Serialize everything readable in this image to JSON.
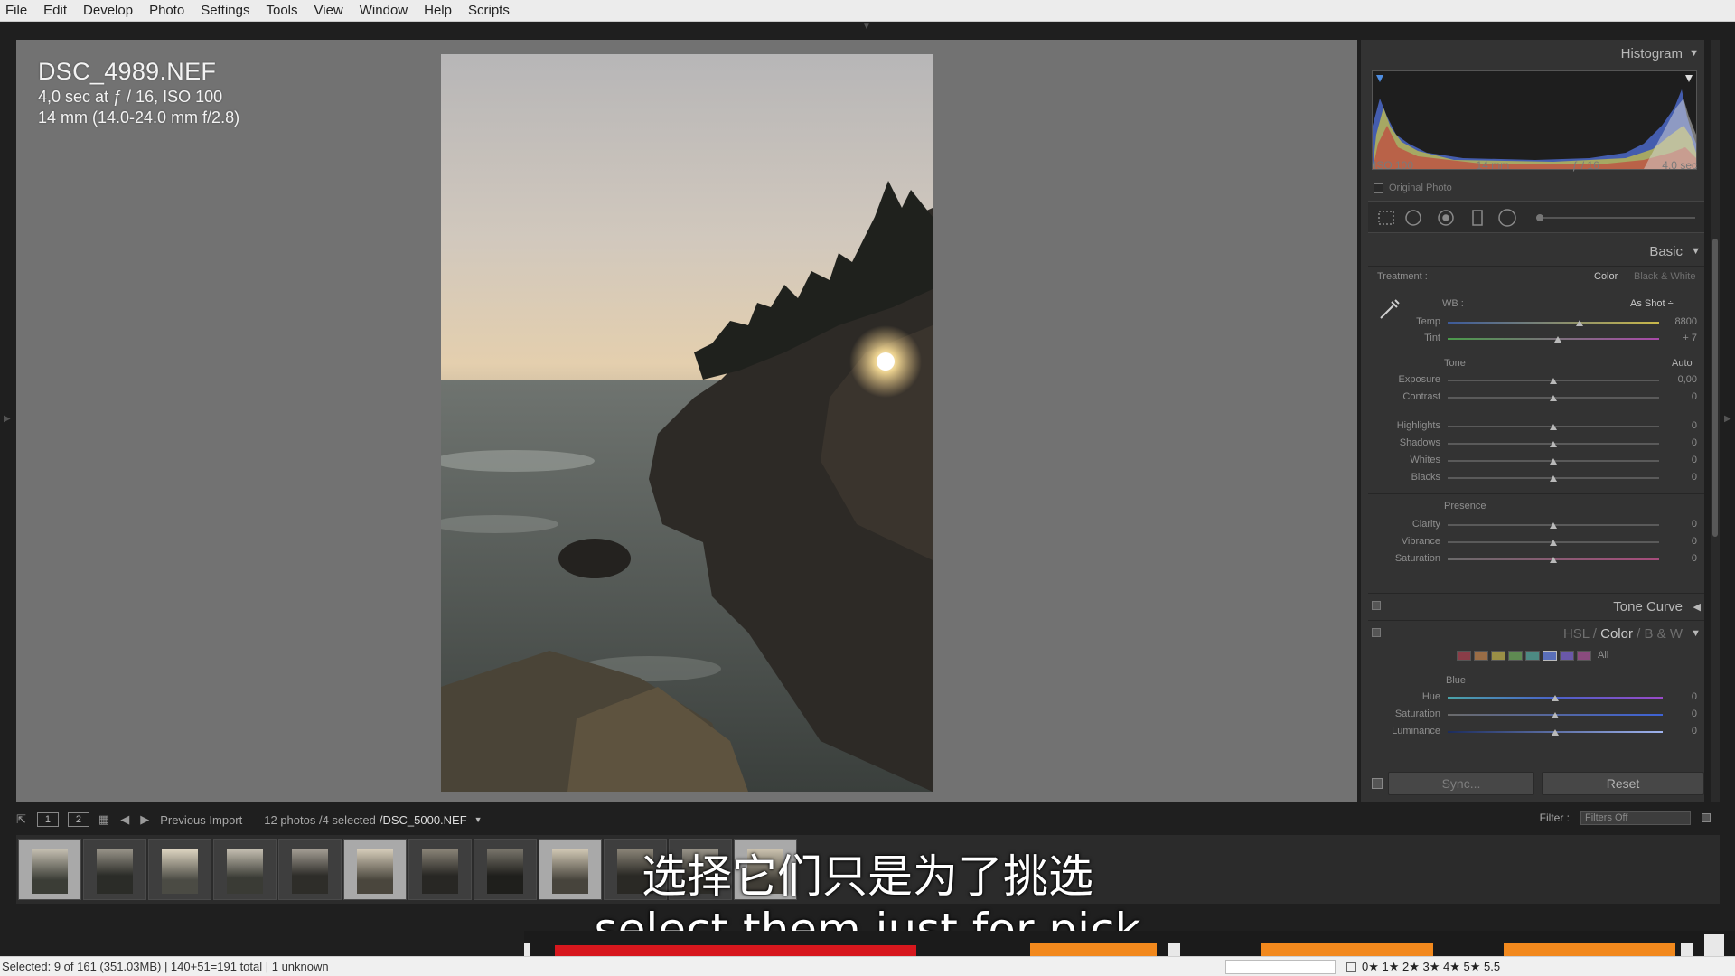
{
  "menu": [
    "File",
    "Edit",
    "Develop",
    "Photo",
    "Settings",
    "Tools",
    "View",
    "Window",
    "Help",
    "Scripts"
  ],
  "photo_info": {
    "filename": "DSC_4989.NEF",
    "exposure": "4,0 sec at ƒ / 16, ISO 100",
    "lens": "14 mm (14.0-24.0 mm f/2.8)"
  },
  "histogram": {
    "title": "Histogram",
    "iso": "ISO 100",
    "focal": "14 mm",
    "aperture": "ƒ / 16",
    "shutter": "4.0 sec",
    "original_photo": "Original Photo"
  },
  "basic": {
    "title": "Basic",
    "treatment_label": "Treatment :",
    "treatment_color": "Color",
    "treatment_bw": "Black & White",
    "wb_label": "WB :",
    "wb_value": "As Shot ÷",
    "temp_label": "Temp",
    "temp_value": "8800",
    "tint_label": "Tint",
    "tint_value": "+ 7",
    "tone_label": "Tone",
    "auto_label": "Auto",
    "exposure_label": "Exposure",
    "exposure_value": "0,00",
    "contrast_label": "Contrast",
    "contrast_value": "0",
    "highlights_label": "Highlights",
    "highlights_value": "0",
    "shadows_label": "Shadows",
    "shadows_value": "0",
    "whites_label": "Whites",
    "whites_value": "0",
    "blacks_label": "Blacks",
    "blacks_value": "0",
    "presence_label": "Presence",
    "clarity_label": "Clarity",
    "clarity_value": "0",
    "vibrance_label": "Vibrance",
    "vibrance_value": "0",
    "saturation_label": "Saturation",
    "saturation_value": "0"
  },
  "tone_curve": {
    "title": "Tone Curve"
  },
  "hsl": {
    "tab_hsl": "HSL",
    "sep": "/",
    "tab_color": "Color",
    "tab_bw": "B & W",
    "all_label": "All",
    "swatch_colors": [
      "#8a3d48",
      "#9a6d46",
      "#9a8f46",
      "#5f8a52",
      "#4d8a83",
      "#5a6fba",
      "#6a58a8",
      "#8a4b7e"
    ],
    "blue_label": "Blue",
    "hue_label": "Hue",
    "hue_value": "0",
    "sat_label": "Saturation",
    "sat_value": "0",
    "lum_label": "Luminance",
    "lum_value": "0"
  },
  "buttons": {
    "sync": "Sync...",
    "reset": "Reset"
  },
  "filmstrip": {
    "view1": "1",
    "view2": "2",
    "source": "Previous Import",
    "count": "12 photos /4 selected",
    "current": "/DSC_5000.NEF",
    "filter_label": "Filter :",
    "filter_value": "Filters Off"
  },
  "subtitles": {
    "chinese": "选择它们只是为了挑选",
    "english": "select them just for pick"
  },
  "status": {
    "left": "Selected: 9 of 161 (351.03MB) | 140+51=191 total | 1 unknown",
    "ratings": "0★ 1★ 2★ 3★ 4★ 5★ 5.5"
  }
}
